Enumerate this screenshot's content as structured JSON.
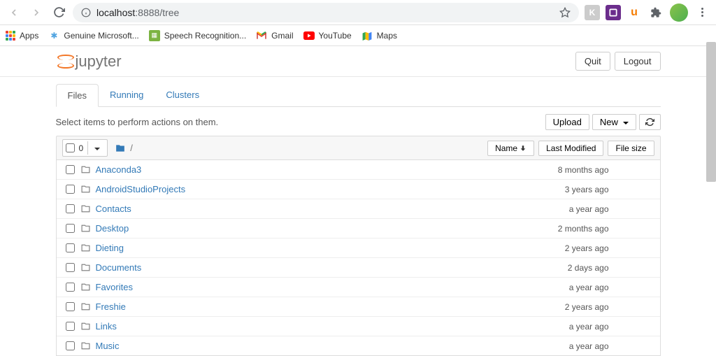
{
  "browser": {
    "url_host": "localhost",
    "url_port": ":8888",
    "url_path": "/tree"
  },
  "bookmarks": [
    {
      "label": "Apps",
      "icon": "apps"
    },
    {
      "label": "Genuine Microsoft...",
      "icon": "ms"
    },
    {
      "label": "Speech Recognition...",
      "icon": "sr"
    },
    {
      "label": "Gmail",
      "icon": "gmail"
    },
    {
      "label": "YouTube",
      "icon": "yt"
    },
    {
      "label": "Maps",
      "icon": "maps"
    }
  ],
  "jupyter": {
    "logo_text": "jupyter",
    "quit_label": "Quit",
    "logout_label": "Logout"
  },
  "tabs": [
    {
      "label": "Files",
      "active": true
    },
    {
      "label": "Running",
      "active": false
    },
    {
      "label": "Clusters",
      "active": false
    }
  ],
  "toolbar": {
    "hint": "Select items to perform actions on them.",
    "upload_label": "Upload",
    "new_label": "New"
  },
  "list_header": {
    "select_count": "0",
    "breadcrumb_root": "/",
    "name_label": "Name",
    "modified_label": "Last Modified",
    "size_label": "File size"
  },
  "files": [
    {
      "name": "Anaconda3",
      "modified": "8 months ago"
    },
    {
      "name": "AndroidStudioProjects",
      "modified": "3 years ago"
    },
    {
      "name": "Contacts",
      "modified": "a year ago"
    },
    {
      "name": "Desktop",
      "modified": "2 months ago"
    },
    {
      "name": "Dieting",
      "modified": "2 years ago"
    },
    {
      "name": "Documents",
      "modified": "2 days ago"
    },
    {
      "name": "Favorites",
      "modified": "a year ago"
    },
    {
      "name": "Freshie",
      "modified": "2 years ago"
    },
    {
      "name": "Links",
      "modified": "a year ago"
    },
    {
      "name": "Music",
      "modified": "a year ago"
    }
  ]
}
